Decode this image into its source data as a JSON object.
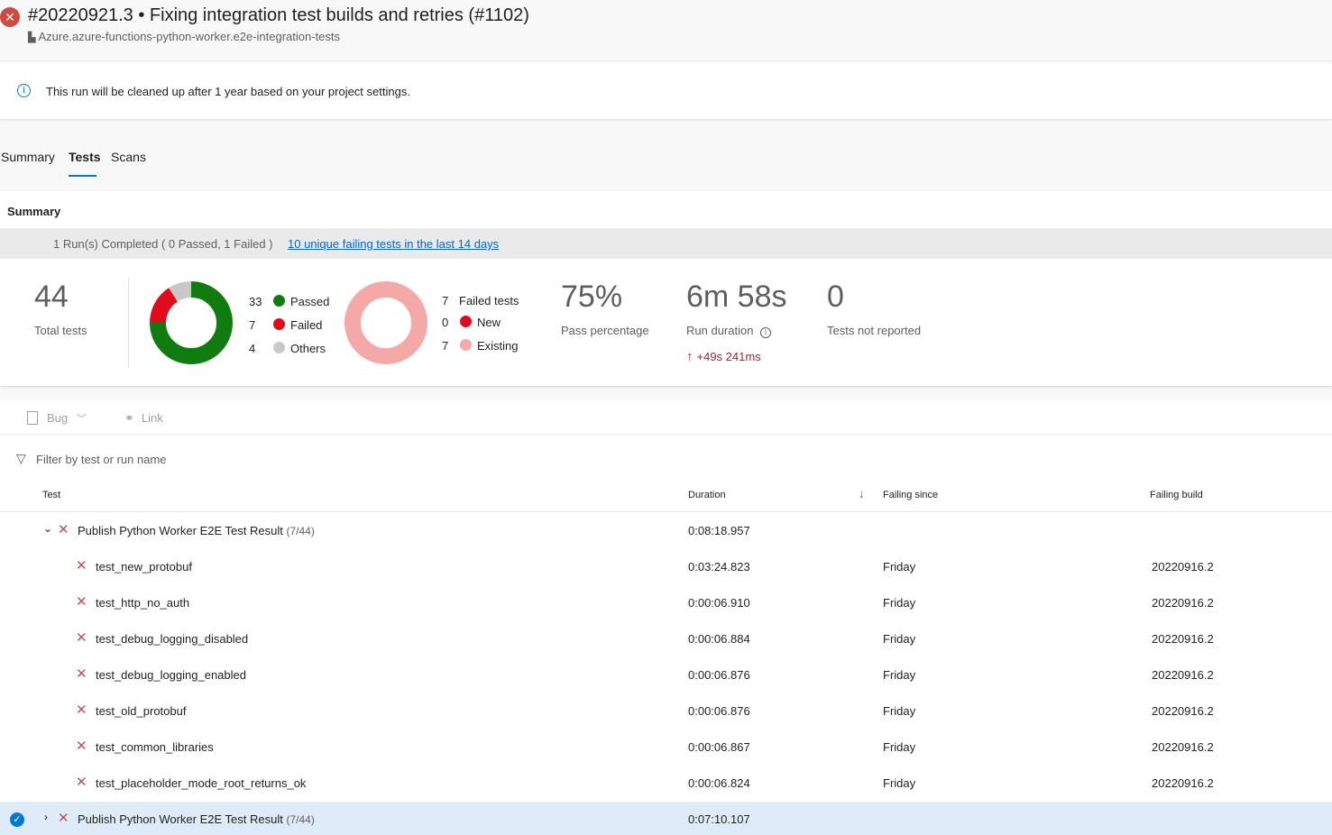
{
  "header": {
    "title": "#20220921.3 • Fixing integration test builds and retries (#1102)",
    "pipeline": "Azure.azure-functions-python-worker.e2e-integration-tests",
    "status_glyph": "✕",
    "status_color": "#cd4a45"
  },
  "banner": {
    "text": "This run will be cleaned up after 1 year based on your project settings."
  },
  "tabs": [
    {
      "label": "Summary"
    },
    {
      "label": "Tests",
      "active": true
    },
    {
      "label": "Scans"
    }
  ],
  "summary": {
    "heading": "Summary",
    "run_completed": "1 Run(s) Completed ( 0 Passed, 1 Failed )",
    "failing_link": "10 unique failing tests in the last 14 days",
    "total_tests": {
      "value": "44",
      "label": "Total tests"
    },
    "outcome_legend": [
      {
        "count": "33",
        "label": "Passed",
        "color": "#107c10"
      },
      {
        "count": "7",
        "label": "Failed",
        "color": "#e00b1c"
      },
      {
        "count": "4",
        "label": "Others",
        "color": "#c8c8c8"
      }
    ],
    "failed_legend": [
      {
        "count": "7",
        "label": "Failed tests"
      },
      {
        "count": "0",
        "label": "New",
        "color": "#e00b1c"
      },
      {
        "count": "7",
        "label": "Existing",
        "color": "#f4a8a8"
      }
    ],
    "pass_percentage": {
      "value": "75%",
      "label": "Pass percentage"
    },
    "run_duration": {
      "value": "6m 58s",
      "label": "Run duration",
      "delta": "+49s 241ms"
    },
    "not_reported": {
      "value": "0",
      "label": "Tests not reported"
    }
  },
  "toolbar": {
    "bug_label": "Bug",
    "link_label": "Link"
  },
  "filter": {
    "placeholder": "Filter by test or run name"
  },
  "table": {
    "columns": {
      "test": "Test",
      "duration": "Duration",
      "failing_since": "Failing since",
      "failing_build": "Failing build"
    },
    "groups": [
      {
        "name": "Publish Python Worker E2E Test Result",
        "count": "(7/44)",
        "duration": "0:08:18.957",
        "expanded": true
      },
      {
        "name": "Publish Python Worker E2E Test Result",
        "count": "(7/44)",
        "duration": "0:07:10.107",
        "expanded": false
      }
    ],
    "rows": [
      {
        "name": "test_new_protobuf",
        "duration": "0:03:24.823",
        "since": "Friday",
        "build": "20220916.2"
      },
      {
        "name": "test_http_no_auth",
        "duration": "0:00:06.910",
        "since": "Friday",
        "build": "20220916.2"
      },
      {
        "name": "test_debug_logging_disabled",
        "duration": "0:00:06.884",
        "since": "Friday",
        "build": "20220916.2"
      },
      {
        "name": "test_debug_logging_enabled",
        "duration": "0:00:06.876",
        "since": "Friday",
        "build": "20220916.2"
      },
      {
        "name": "test_old_protobuf",
        "duration": "0:00:06.876",
        "since": "Friday",
        "build": "20220916.2"
      },
      {
        "name": "test_common_libraries",
        "duration": "0:00:06.867",
        "since": "Friday",
        "build": "20220916.2"
      },
      {
        "name": "test_placeholder_mode_root_returns_ok",
        "duration": "0:00:06.824",
        "since": "Friday",
        "build": "20220916.2"
      }
    ]
  }
}
